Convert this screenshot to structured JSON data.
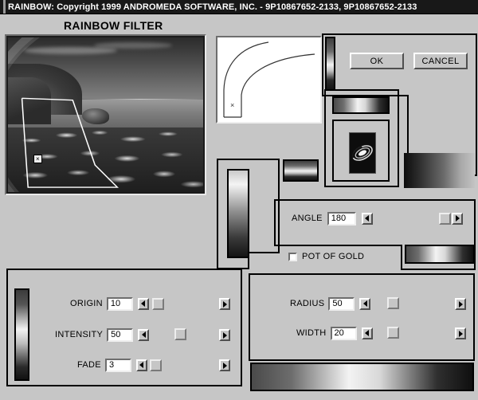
{
  "window": {
    "title": "RAINBOW: Copyright 1999 ANDROMEDA SOFTWARE, INC. - 9P10867652-2133, 9P10867652-2133"
  },
  "heading": "RAINBOW FILTER",
  "buttons": {
    "ok": "OK",
    "cancel": "CANCEL"
  },
  "preview": {
    "marker": "×",
    "curve_marker": "×"
  },
  "angle": {
    "label": "ANGLE",
    "value": "180"
  },
  "pot_of_gold": {
    "label": "POT OF GOLD",
    "checked": false
  },
  "left_sliders": [
    {
      "label": "ORIGIN",
      "value": "10"
    },
    {
      "label": "INTENSITY",
      "value": "50"
    },
    {
      "label": "FADE",
      "value": "3"
    }
  ],
  "right_sliders": [
    {
      "label": "RADIUS",
      "value": "50"
    },
    {
      "label": "WIDTH",
      "value": "20"
    }
  ],
  "colors": {
    "face": "#c6c6c6",
    "titlebar": "#181818",
    "titlebar_text": "#ffffff",
    "field": "#ffffff",
    "shadow": "#000000"
  }
}
